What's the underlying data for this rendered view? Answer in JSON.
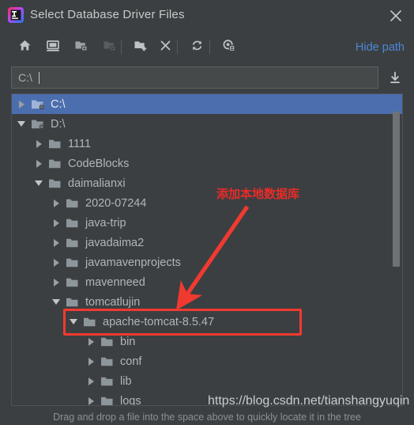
{
  "window": {
    "title": "Select Database Driver Files",
    "app_icon": "intellij-idea-icon",
    "close_icon": "close-icon"
  },
  "toolbar": {
    "buttons": [
      {
        "name": "home-button",
        "icon": "home-icon",
        "tooltip": "Home",
        "enabled": true
      },
      {
        "name": "desktop-button",
        "icon": "desktop-icon",
        "tooltip": "Desktop",
        "enabled": true
      },
      {
        "name": "project-dir-button",
        "icon": "project-folder-icon",
        "tooltip": "Project Directory",
        "enabled": true
      },
      {
        "name": "module-dir-button",
        "icon": "module-folder-icon",
        "tooltip": "Module Directory",
        "enabled": false
      },
      {
        "name": "new-folder-button",
        "icon": "new-folder-icon",
        "tooltip": "New Folder",
        "enabled": true
      },
      {
        "name": "delete-button",
        "icon": "close-x-icon",
        "tooltip": "Delete",
        "enabled": true
      },
      {
        "name": "refresh-button",
        "icon": "refresh-icon",
        "tooltip": "Refresh",
        "enabled": true
      },
      {
        "name": "show-hidden-button",
        "icon": "show-hidden-files-icon",
        "tooltip": "Show Hidden Files",
        "enabled": true
      }
    ],
    "hide_path_label": "Hide path"
  },
  "path_field": {
    "value": "C:\\",
    "placeholder": "",
    "import_icon": "import-arrow-icon"
  },
  "tree": {
    "rows": [
      {
        "label": "C:\\",
        "depth": 0,
        "state": "collapsed",
        "icon": "drive-folder-icon",
        "selected": true
      },
      {
        "label": "D:\\",
        "depth": 0,
        "state": "expanded",
        "icon": "drive-folder-icon",
        "selected": false
      },
      {
        "label": "1111",
        "depth": 1,
        "state": "collapsed",
        "icon": "folder-icon",
        "selected": false
      },
      {
        "label": "CodeBlocks",
        "depth": 1,
        "state": "collapsed",
        "icon": "folder-icon",
        "selected": false
      },
      {
        "label": "daimalianxi",
        "depth": 1,
        "state": "expanded",
        "icon": "folder-icon",
        "selected": false
      },
      {
        "label": "2020-07244",
        "depth": 2,
        "state": "collapsed",
        "icon": "folder-icon",
        "selected": false
      },
      {
        "label": "java-trip",
        "depth": 2,
        "state": "collapsed",
        "icon": "folder-icon",
        "selected": false
      },
      {
        "label": "javadaima2",
        "depth": 2,
        "state": "collapsed",
        "icon": "folder-icon",
        "selected": false
      },
      {
        "label": "javamavenprojects",
        "depth": 2,
        "state": "collapsed",
        "icon": "folder-icon",
        "selected": false
      },
      {
        "label": "mavenneed",
        "depth": 2,
        "state": "collapsed",
        "icon": "folder-icon",
        "selected": false
      },
      {
        "label": "tomcatlujin",
        "depth": 2,
        "state": "expanded",
        "icon": "folder-icon",
        "selected": false
      },
      {
        "label": "apache-tomcat-8.5.47",
        "depth": 3,
        "state": "expanded",
        "icon": "folder-icon",
        "selected": false
      },
      {
        "label": "bin",
        "depth": 4,
        "state": "collapsed",
        "icon": "folder-icon",
        "selected": false
      },
      {
        "label": "conf",
        "depth": 4,
        "state": "collapsed",
        "icon": "folder-icon",
        "selected": false
      },
      {
        "label": "lib",
        "depth": 4,
        "state": "collapsed",
        "icon": "folder-icon",
        "selected": false
      },
      {
        "label": "logs",
        "depth": 4,
        "state": "collapsed",
        "icon": "folder-icon",
        "selected": false
      }
    ],
    "scrollbar": "vertical-scrollbar"
  },
  "annotations": {
    "note_text": "添加本地数据库",
    "arrow": "red-arrow-annotation",
    "highlight_rect": "red-rectangle-annotation",
    "color": "#F03A30"
  },
  "watermark": {
    "text": "https://blog.csdn.net/tianshangyuqin"
  },
  "footer": {
    "hint": "Drag and drop a file into the space above to quickly locate it in the tree"
  },
  "colors": {
    "background": "#3C3F41",
    "selection": "#4B6EAF",
    "link": "#4A88D8",
    "text": "#B2B6B8",
    "annotation": "#F03A30"
  }
}
